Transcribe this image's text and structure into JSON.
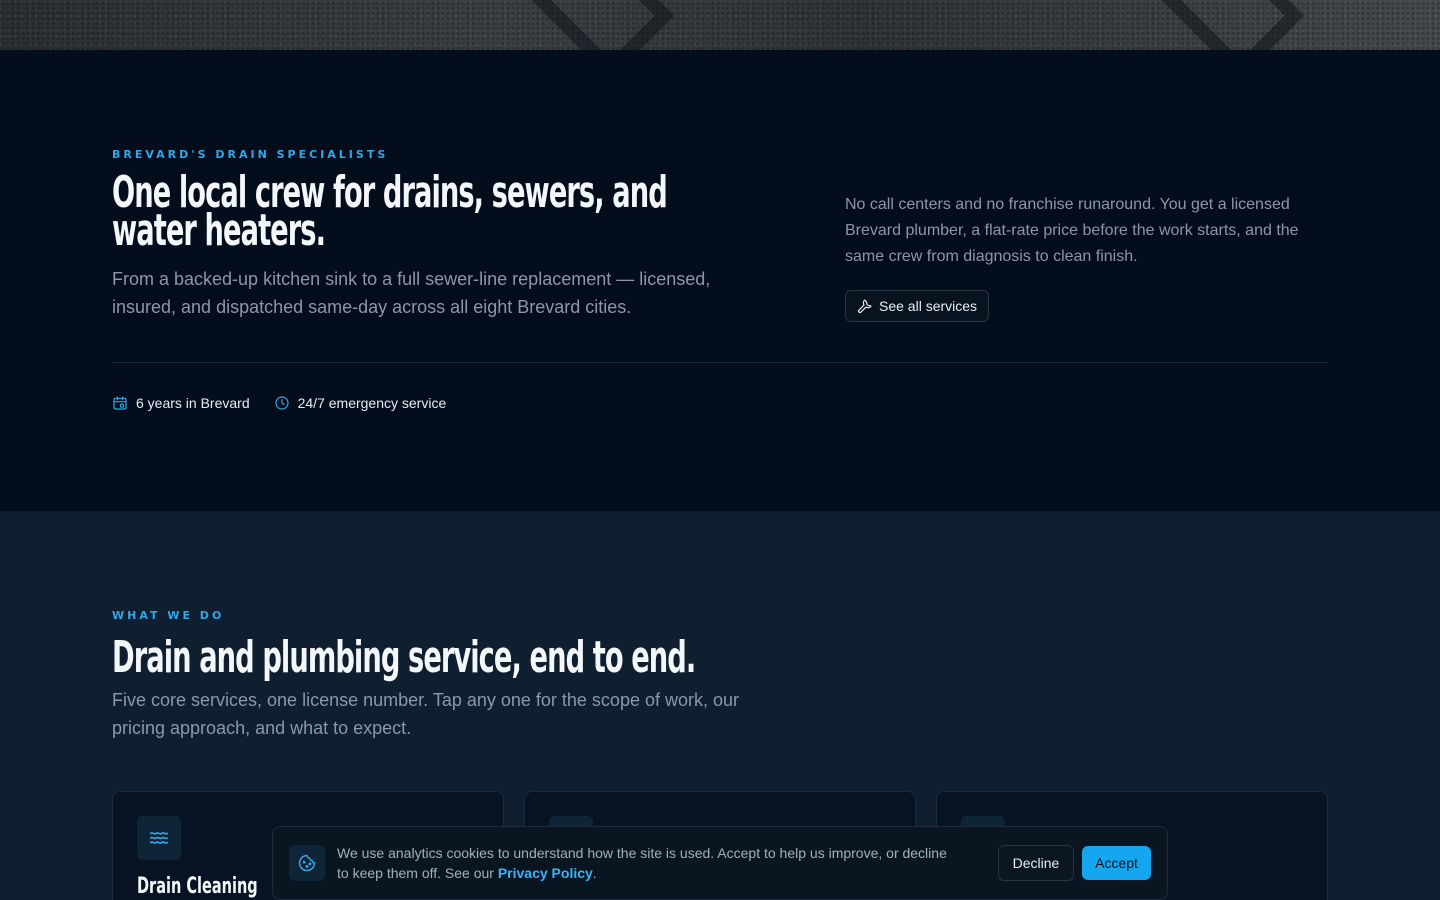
{
  "intro": {
    "eyebrow": "BREVARD'S DRAIN SPECIALISTS",
    "title": "One local crew for drains, sewers, and water heaters.",
    "lead": "From a backed-up kitchen sink to a full sewer-line replacement — licensed, insured, and dispatched same-day across all eight Brevard cities.",
    "side_text": "No call centers and no franchise runaround. You get a licensed Brevard plumber, a flat-rate price before the work starts, and the same crew from diagnosis to clean finish.",
    "cta_label": "See all services",
    "facts": [
      {
        "icon": "calendar-icon",
        "label": "6 years in Brevard"
      },
      {
        "icon": "clock-icon",
        "label": "24/7 emergency service"
      }
    ]
  },
  "services": {
    "eyebrow": "WHAT WE DO",
    "title": "Drain and plumbing service, end to end.",
    "lead": "Five core services, one license number. Tap any one for the scope of work, our pricing approach, and what to expect.",
    "cards": [
      {
        "icon": "waves-icon",
        "title": "Drain Cleaning"
      },
      {
        "icon": "service-icon",
        "title": ""
      },
      {
        "icon": "service-icon",
        "title": ""
      }
    ]
  },
  "cookie": {
    "text": "We use analytics cookies to understand how the site is used. Accept to help us improve, or decline to keep them off. See our ",
    "link_label": "Privacy Policy",
    "trailing": ".",
    "decline_label": "Decline",
    "accept_label": "Accept"
  },
  "colors": {
    "accent": "#14a6ef",
    "eyebrow": "#2fa8ea",
    "hero_bg": "#040d1b",
    "services_bg": "#0f1f2f"
  }
}
